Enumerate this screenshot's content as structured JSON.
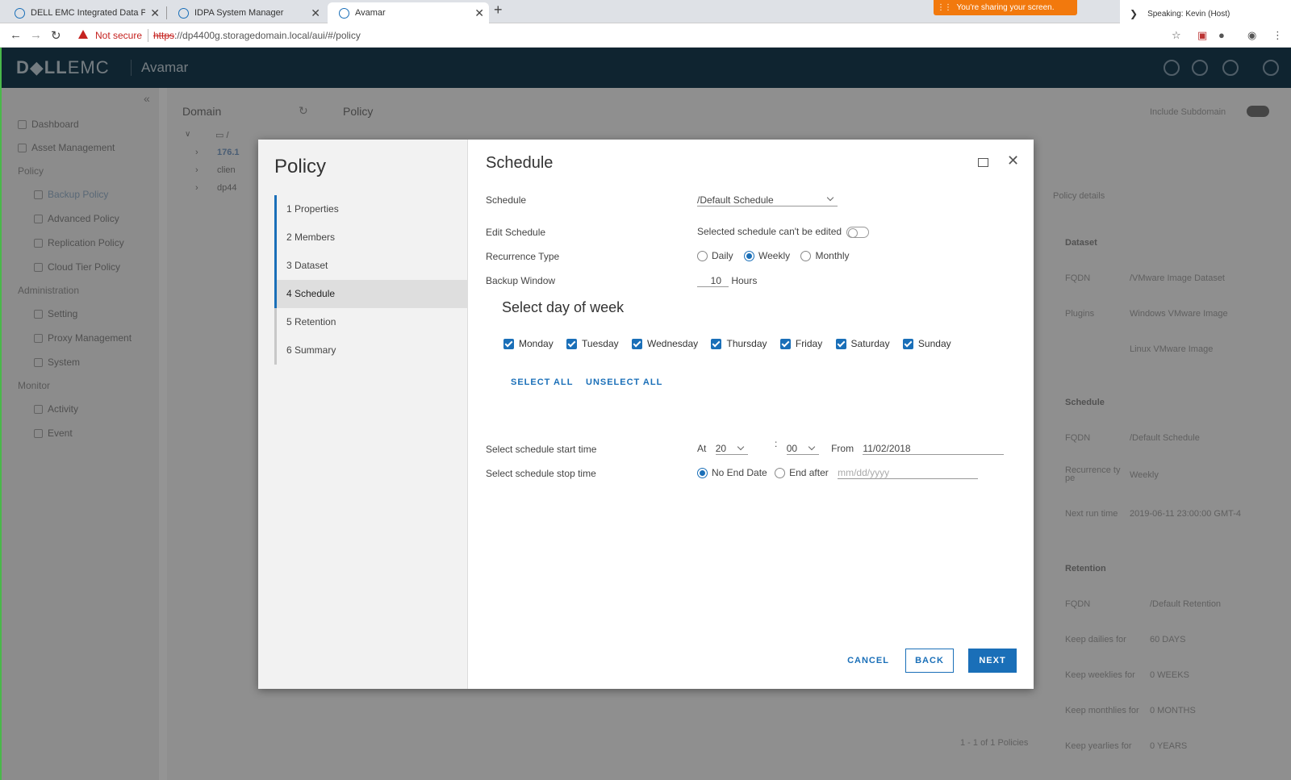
{
  "browser": {
    "tabs": [
      {
        "title": "DELL EMC Integrated Data Protec"
      },
      {
        "title": "IDPA System Manager"
      },
      {
        "title": "Avamar"
      }
    ],
    "security": "Not secure",
    "url_scheme": "https",
    "url_rest": "://dp4400g.storagedomain.local/aui/#/policy",
    "sharing_banner": "You're sharing your screen.",
    "speaking": "Speaking: Kevin (Host)"
  },
  "app": {
    "logo_dell": "D◆LL",
    "logo_emc": "EMC",
    "name": "Avamar"
  },
  "sidebar": {
    "items": [
      {
        "label": "Dashboard"
      },
      {
        "label": "Asset Management"
      },
      {
        "label": "Policy"
      },
      {
        "label": "Backup Policy"
      },
      {
        "label": "Advanced Policy"
      },
      {
        "label": "Replication Policy"
      },
      {
        "label": "Cloud Tier Policy"
      },
      {
        "label": "Administration"
      },
      {
        "label": "Setting"
      },
      {
        "label": "Proxy Management"
      },
      {
        "label": "System"
      },
      {
        "label": "Monitor"
      },
      {
        "label": "Activity"
      },
      {
        "label": "Event"
      }
    ]
  },
  "domain": {
    "title": "Domain",
    "root": "/",
    "nodes": [
      "176.1",
      "clien",
      "dp44"
    ]
  },
  "policy_bg": {
    "title": "Policy",
    "include_subdomain": "Include Subdomain",
    "details_link": "Policy details",
    "dataset_head": "Dataset",
    "fqdn_label": "FQDN",
    "dataset_fqdn": "/VMware Image Dataset",
    "plugins_label": "Plugins",
    "plugin1": "Windows VMware Image",
    "plugin2": "Linux VMware Image",
    "schedule_head": "Schedule",
    "schedule_fqdn": "/Default Schedule",
    "recurrence_label": "Recurrence ty pe",
    "recurrence_value": "Weekly",
    "next_run_label": "Next run time",
    "next_run_value": "2019-06-11 23:00:00 GMT-4",
    "retention_head": "Retention",
    "retention_fqdn": "/Default Retention",
    "keep_dailies_label": "Keep dailies for",
    "keep_dailies": "60 DAYS",
    "keep_weeklies_label": "Keep weeklies for",
    "keep_weeklies": "0 WEEKS",
    "keep_monthlies_label": "Keep monthlies for",
    "keep_monthlies": "0 MONTHS",
    "keep_yearlies_label": "Keep yearlies for",
    "keep_yearlies": "0 YEARS",
    "pagination": "1 - 1 of 1 Policies"
  },
  "modal": {
    "title": "Policy",
    "steps": [
      {
        "label": "1  Properties"
      },
      {
        "label": "2  Members"
      },
      {
        "label": "3  Dataset"
      },
      {
        "label": "4  Schedule"
      },
      {
        "label": "5  Retention"
      },
      {
        "label": "6  Summary"
      }
    ],
    "section_title": "Schedule",
    "schedule_label": "Schedule",
    "schedule_value": "/Default Schedule",
    "edit_label": "Edit Schedule",
    "edit_note": "Selected schedule can't be edited",
    "recurrence_label": "Recurrence Type",
    "recurrence_options": [
      "Daily",
      "Weekly",
      "Monthly"
    ],
    "recurrence_selected": "Weekly",
    "window_label": "Backup Window",
    "window_value": "10",
    "window_unit": "Hours",
    "days_title": "Select day of week",
    "days": [
      "Monday",
      "Tuesday",
      "Wednesday",
      "Thursday",
      "Friday",
      "Saturday",
      "Sunday"
    ],
    "select_all": "SELECT ALL",
    "unselect_all": "UNSELECT ALL",
    "start_label": "Select schedule start time",
    "at_label": "At",
    "hour": "20",
    "minute": "00",
    "colon": ":",
    "from_label": "From",
    "from_date": "11/02/2018",
    "stop_label": "Select schedule stop time",
    "no_end": "No End Date",
    "end_after": "End after",
    "end_placeholder": "mm/dd/yyyy",
    "cancel": "CANCEL",
    "back": "BACK",
    "next": "NEXT"
  },
  "colors": {
    "accent": "#1a6fb8",
    "header": "#1a3e54",
    "share": "#f2790d"
  }
}
